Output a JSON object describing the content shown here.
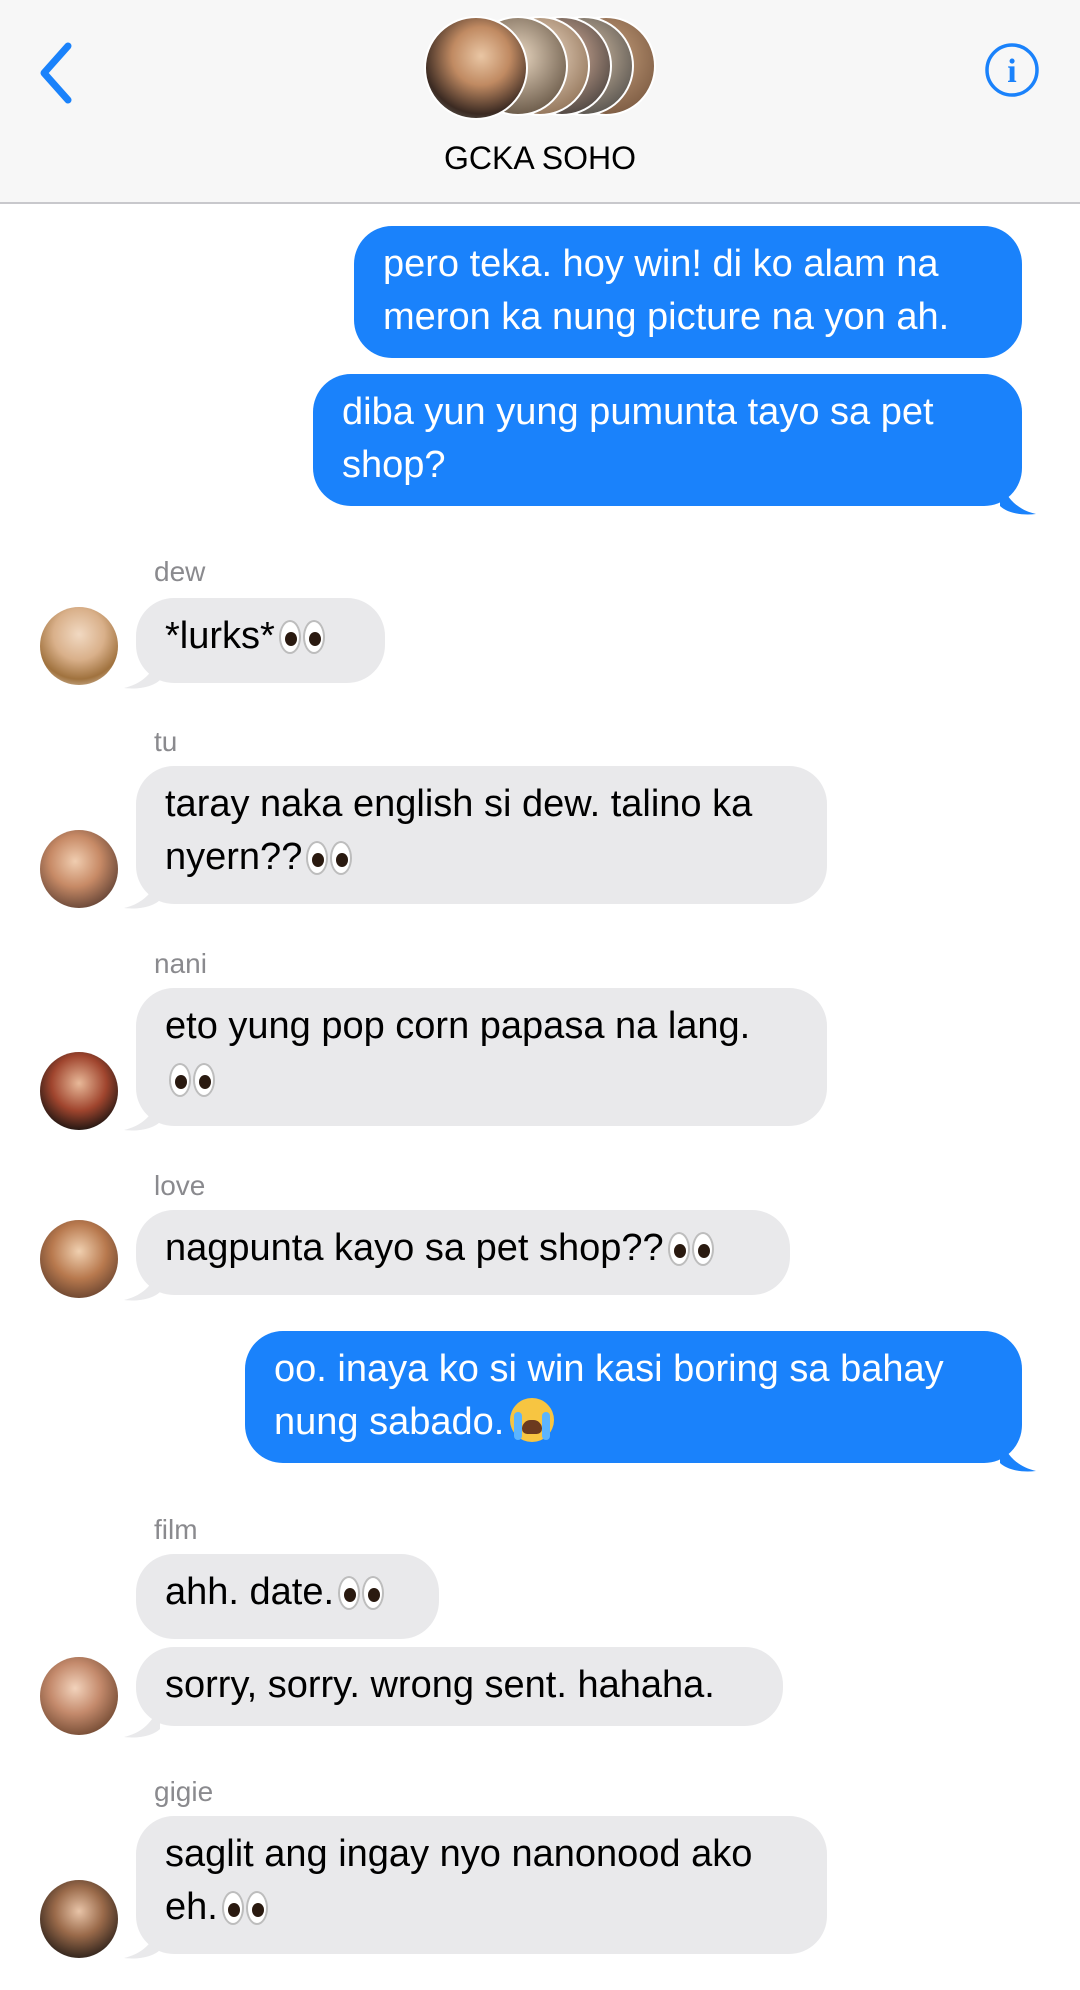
{
  "header": {
    "group_name": "GCKA SOHO",
    "back_icon": "chevron-left-icon",
    "info_icon": "info-icon",
    "accent_color": "#1a82fb"
  },
  "messages": [
    {
      "direction": "out",
      "text": "pero teka. hoy win! di ko alam na meron ka nung picture na yon ah."
    },
    {
      "direction": "out",
      "text": "diba yun yung pumunta tayo sa pet shop?"
    },
    {
      "direction": "in",
      "sender": "dew",
      "text": "*lurks*",
      "emoji": "eyes"
    },
    {
      "direction": "in",
      "sender": "tu",
      "text": "taray naka english si dew. talino ka nyern??",
      "emoji": "eyes"
    },
    {
      "direction": "in",
      "sender": "nani",
      "text": "eto yung pop corn papasa na lang.",
      "emoji": "eyes"
    },
    {
      "direction": "in",
      "sender": "love",
      "text": "nagpunta kayo sa pet shop??",
      "emoji": "eyes"
    },
    {
      "direction": "out",
      "text": "oo. inaya ko si win kasi boring sa bahay nung sabado.",
      "emoji": "loudly-crying-face"
    },
    {
      "direction": "in",
      "sender": "film",
      "text": "ahh. date.",
      "emoji": "eyes"
    },
    {
      "direction": "in",
      "sender": "film",
      "text": "sorry, sorry. wrong sent. hahaha."
    },
    {
      "direction": "in",
      "sender": "gigie",
      "text": "saglit ang ingay nyo nanonood ako eh.",
      "emoji": "eyes"
    }
  ],
  "colors": {
    "outgoing_bubble": "#1a82fb",
    "incoming_bubble": "#e9e9eb",
    "sender_name": "#8a8a8e"
  }
}
